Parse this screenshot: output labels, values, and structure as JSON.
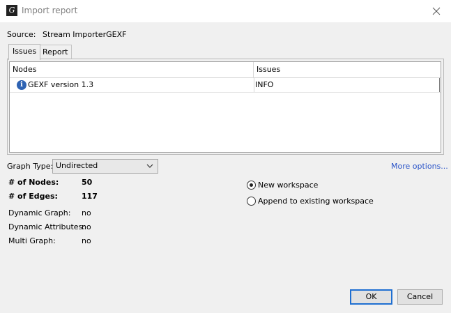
{
  "window": {
    "title": "Import report"
  },
  "source": {
    "label": "Source:",
    "value": "Stream ImporterGEXF"
  },
  "tabs": [
    {
      "label": "Issues"
    },
    {
      "label": "Report"
    }
  ],
  "issues_table": {
    "columns": [
      "Nodes",
      "Issues"
    ],
    "rows": [
      {
        "icon": "info-icon",
        "message": "GEXF version 1.3",
        "level": "INFO"
      }
    ]
  },
  "graph_type": {
    "label": "Graph Type:",
    "value": "Undirected"
  },
  "more_options": "More options...",
  "stats": {
    "nodes_label": "# of Nodes:",
    "nodes_value": "50",
    "edges_label": "# of Edges:",
    "edges_value": "117",
    "dynamic_graph_label": "Dynamic Graph:",
    "dynamic_graph_value": "no",
    "dynamic_attributes_label": "Dynamic Attributes:",
    "dynamic_attributes_value": "no",
    "multi_graph_label": "Multi Graph:",
    "multi_graph_value": "no"
  },
  "workspace": {
    "options": [
      {
        "label": "New workspace",
        "selected": true
      },
      {
        "label": "Append to existing workspace",
        "selected": false
      }
    ]
  },
  "buttons": {
    "ok": "OK",
    "cancel": "Cancel"
  },
  "colors": {
    "accent": "#2a54c8",
    "default_button_border": "#1f6fd1",
    "info_icon": "#2e63b3"
  }
}
